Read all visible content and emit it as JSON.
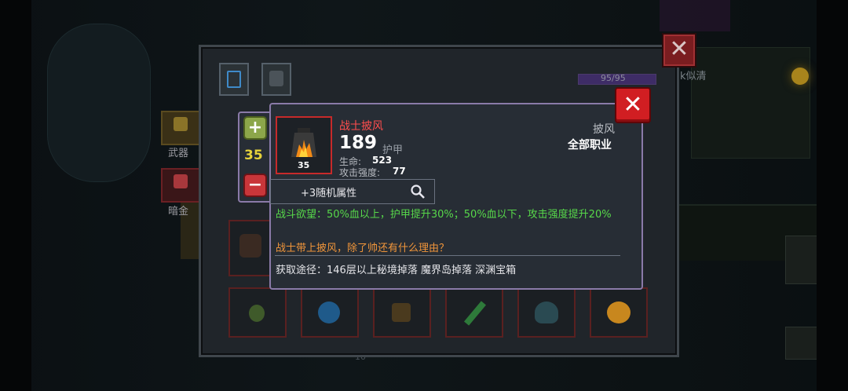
{
  "item": {
    "name": "战士披风",
    "armor_value": "189",
    "armor_label": "护甲",
    "level": "35",
    "stats": [
      {
        "label": "生命:",
        "value": "523"
      },
      {
        "label": "攻击强度:",
        "value": "77"
      }
    ],
    "slot_type": "披风",
    "class_req": "全部职业",
    "random_attrs": "+3随机属性",
    "effect": "战斗欲望：50%血以上，护甲提升30%；50%血以下，攻击强度提升20%",
    "flavor": "战士带上披风，除了帅还有什么理由？",
    "source": "获取途径：146层以上秘境掉落 魔界岛掉落 深渊宝箱"
  },
  "level_control": {
    "value": "35",
    "plus": "+",
    "minus": "−"
  },
  "bag": {
    "capacity": "95/95",
    "side_labels": {
      "weapon": "武器",
      "gem": "暗金"
    }
  },
  "background": {
    "npc_name_partial": "k似清",
    "floor_text_partial": "10"
  },
  "colors": {
    "name_red": "#ff4d4d",
    "effect_green": "#57d84a",
    "flavor_orange": "#f0953a",
    "popup_border": "#8a7aa8"
  },
  "icons": {
    "popup_close": "close-x-icon",
    "magnifier": "magnifier-icon",
    "cape": "flame-cape-icon"
  }
}
